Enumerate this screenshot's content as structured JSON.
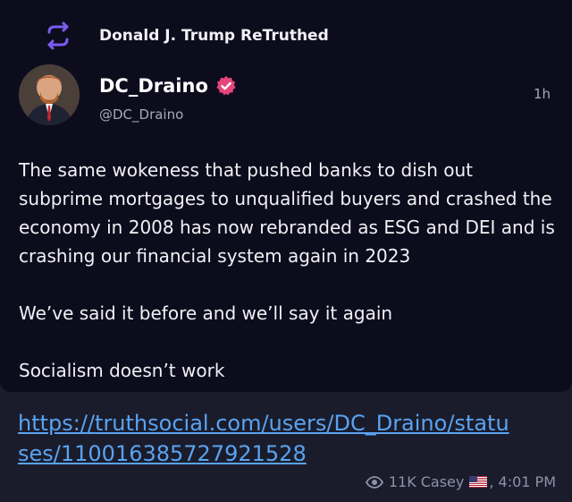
{
  "header": {
    "retruth_label": "Donald J. Trump ReTruthed"
  },
  "post": {
    "display_name": "DC_Draino",
    "handle": "@DC_Draino",
    "time": "1h",
    "paragraphs": [
      "The same wokeness that pushed banks to dish out subprime mortgages to unqualified buyers and crashed the economy in 2008 has now rebranded as ESG and DEI and is crashing our financial system again in 2023",
      "We’ve said it before and we’ll say it again",
      "Socialism doesn’t work"
    ]
  },
  "message": {
    "link": "https://truthsocial.com/users/DC_Draino/statuses/110016385727921528",
    "views": "11K",
    "author": "Casey",
    "flag": "us-flag",
    "time": ", 4:01 PM"
  },
  "icons": {
    "retruth": "retruth-icon",
    "verified": "verified-icon",
    "views": "eye-icon"
  },
  "colors": {
    "accent": "#7b5cf0",
    "verified": "#e6457a",
    "link": "#5aa3f0"
  }
}
